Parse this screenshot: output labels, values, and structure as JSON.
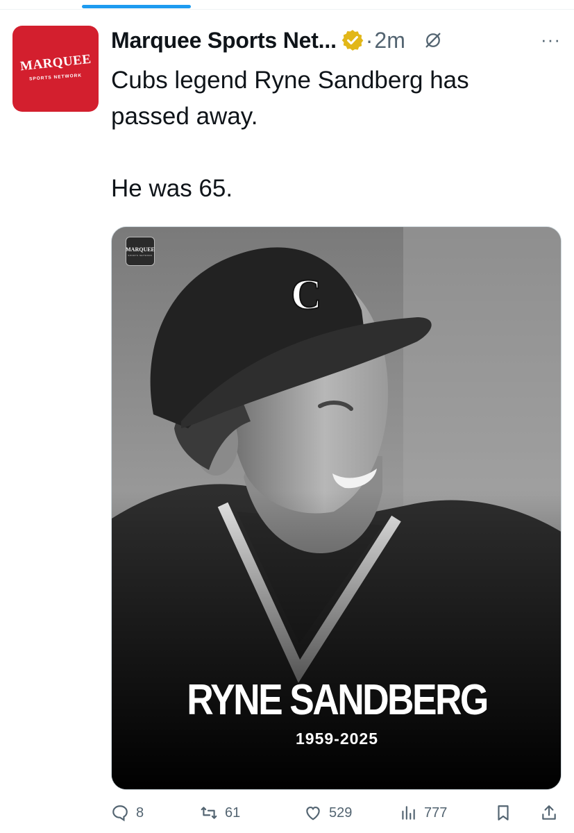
{
  "tweet": {
    "author_name": "Marquee Sports Net...",
    "timestamp": "2m",
    "dot": "·",
    "avatar": {
      "brand": "MARQUEE",
      "subtitle": "SPORTS NETWORK",
      "color": "#d31f2e"
    },
    "text": "Cubs legend Ryne Sandberg has\npassed away.\n\nHe was 65.",
    "more": "···"
  },
  "media": {
    "logo_text": "MARQUEE",
    "logo_sub": "SPORTS NETWORK",
    "title": "RYNE SANDBERG",
    "years": "1959-2025",
    "cap_letter": "C"
  },
  "actions": {
    "replies": "8",
    "reposts": "61",
    "likes": "529",
    "views": "777"
  },
  "colors": {
    "accent": "#1d9bf0",
    "verified": "#e2b719",
    "muted": "#536471"
  },
  "icons": [
    "verified-badge-icon",
    "grok-icon",
    "more-icon",
    "reply-icon",
    "repost-icon",
    "like-icon",
    "views-icon",
    "bookmark-icon",
    "share-icon"
  ]
}
